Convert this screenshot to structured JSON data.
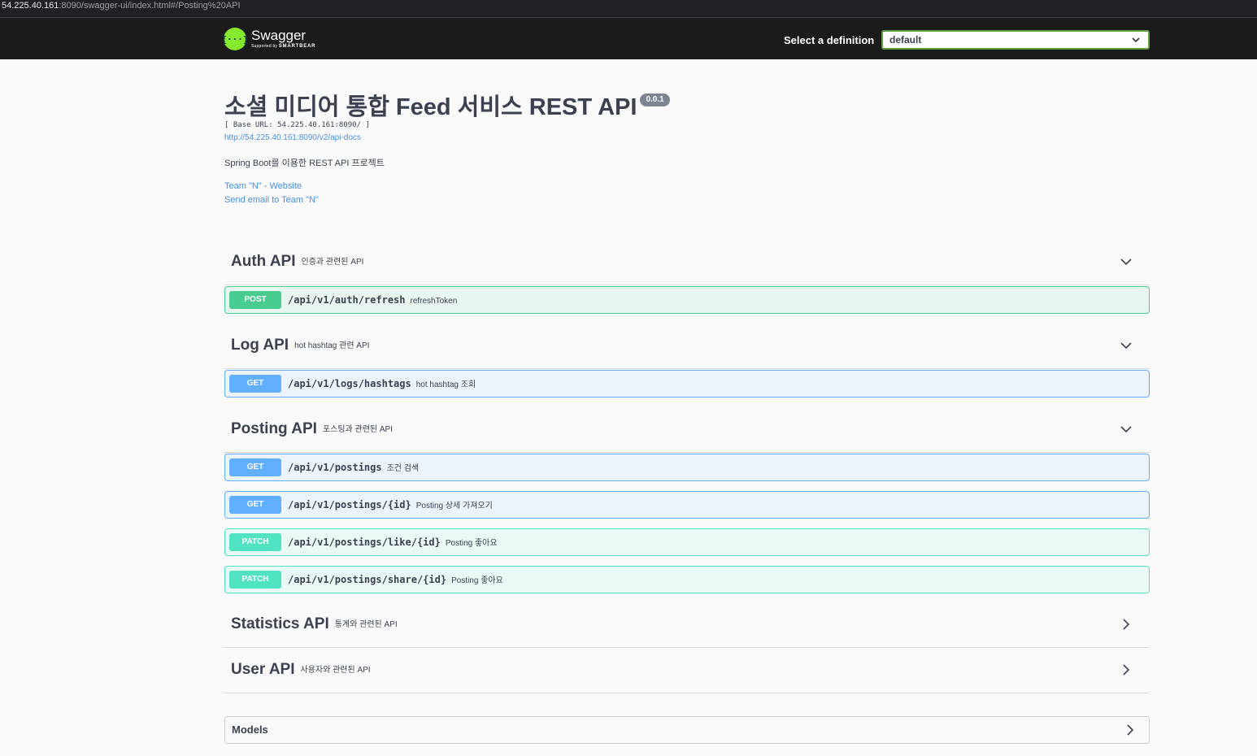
{
  "browser": {
    "url_host": "54.225.40.161",
    "url_rest": ":8090/swagger-ui/index.html#/Posting%20API"
  },
  "topbar": {
    "logo_glyph": "{···}",
    "logo_name": "Swagger",
    "logo_sub_prefix": "Supported by ",
    "logo_sub_brand": "SMARTBEAR",
    "definition_label": "Select a definition",
    "definition_value": "default"
  },
  "info": {
    "title": "소셜 미디어 통합 Feed 서비스 REST API",
    "version": "0.0.1",
    "base_url": "[ Base URL: 54.225.40.161:8090/ ]",
    "docs_link": "http://54.225.40.161:8090/v2/api-docs",
    "description": "Spring Boot를 이용한 REST API 프로젝트",
    "website_link": "Team \"N\" - Website",
    "email_link": "Send email to Team \"N\""
  },
  "tags": [
    {
      "name": "Auth API",
      "description": "인증과 관련된 API",
      "expanded": true,
      "operations": [
        {
          "method": "POST",
          "path": "/api/v1/auth/refresh",
          "summary": "refreshToken"
        }
      ]
    },
    {
      "name": "Log API",
      "description": "hot hashtag 관련 API",
      "expanded": true,
      "operations": [
        {
          "method": "GET",
          "path": "/api/v1/logs/hashtags",
          "summary": "hot hashtag 조회"
        }
      ]
    },
    {
      "name": "Posting API",
      "description": "포스팅과 관련된 API",
      "expanded": true,
      "operations": [
        {
          "method": "GET",
          "path": "/api/v1/postings",
          "summary": "조건 검색"
        },
        {
          "method": "GET",
          "path": "/api/v1/postings/{id}",
          "summary": "Posting 상세 가져오기"
        },
        {
          "method": "PATCH",
          "path": "/api/v1/postings/like/{id}",
          "summary": "Posting 좋아요"
        },
        {
          "method": "PATCH",
          "path": "/api/v1/postings/share/{id}",
          "summary": "Posting 좋아요"
        }
      ]
    },
    {
      "name": "Statistics API",
      "description": "통계와 관련된 API",
      "expanded": false,
      "operations": []
    },
    {
      "name": "User API",
      "description": "사용자와 관련된 API",
      "expanded": false,
      "operations": []
    }
  ],
  "models": {
    "label": "Models"
  },
  "colors": {
    "get": "#61affe",
    "post": "#49cc90",
    "patch": "#50e3c2",
    "topbar": "#1b1b1b",
    "logo": "#85ea2d"
  },
  "icons": {
    "tag_expanded": "chevron-down-icon",
    "tag_collapsed": "chevron-right-icon",
    "select": "chevron-down-icon"
  }
}
